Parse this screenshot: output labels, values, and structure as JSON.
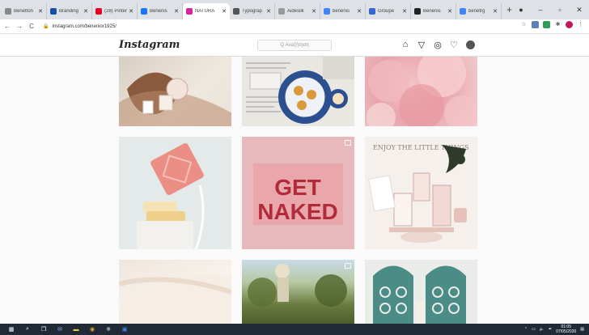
{
  "browser": {
    "tabs": [
      {
        "label": "Benetton",
        "color": "#888"
      },
      {
        "label": "Branding",
        "color": "#1a4fa3"
      },
      {
        "label": "(28) Pinter",
        "color": "#e60023"
      },
      {
        "label": "Benenis",
        "color": "#1877f2"
      },
      {
        "label": "NATURA",
        "color": "#d6249f",
        "active": true
      },
      {
        "label": "Typograp",
        "color": "#555"
      },
      {
        "label": "Aidesilk",
        "color": "#999"
      },
      {
        "label": "benenis",
        "color": "#4285f4"
      },
      {
        "label": "Groupe",
        "color": "#3367d6"
      },
      {
        "label": "Benenis",
        "color": "#222"
      },
      {
        "label": "benetrg",
        "color": "#4285f4"
      }
    ],
    "new_tab": "+",
    "url": "instagram.com/benenior1925/",
    "nav": {
      "back": "←",
      "forward": "→",
      "reload": "C"
    }
  },
  "instagram": {
    "logo": "Instagram",
    "search_placeholder": "Q Αναζήτηση"
  },
  "posts": {
    "p5_text_line1": "GET",
    "p5_text_line2": "NAKED",
    "p6_text": "ENJOY THE LITTLE THINGS"
  },
  "taskbar": {
    "time": "01:05",
    "date": "07/05/2020"
  }
}
